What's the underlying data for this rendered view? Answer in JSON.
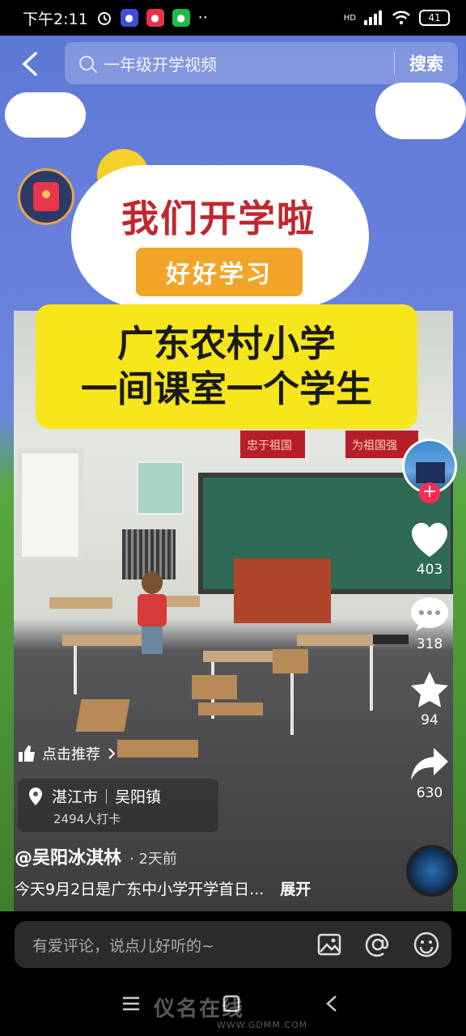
{
  "status_bar": {
    "time": "下午2:11",
    "network": "HD",
    "battery": "41"
  },
  "search": {
    "placeholder": "一年级开学视频",
    "button_label": "搜索"
  },
  "video": {
    "title_line": "我们开学啦",
    "ribbon": "好好学习",
    "headline_line1": "广东农村小学",
    "headline_line2": "一间课室一个学生",
    "banner_left": "忠于祖国",
    "banner_right": "为祖国强"
  },
  "actions": {
    "likes": "403",
    "comments": "318",
    "favorites": "94",
    "shares": "630"
  },
  "recommend": {
    "label": "点击推荐"
  },
  "location": {
    "city": "湛江市",
    "town": "吴阳镇",
    "checkins": "2494人打卡"
  },
  "post": {
    "author": "@吴阳冰淇林",
    "time": "· 2天前",
    "caption": "今天9月2日是广东中小学开学首日...",
    "expand_label": "展开"
  },
  "comment": {
    "placeholder": "有爱评论，说点儿好听的~"
  },
  "watermark": {
    "text": "仪名在线",
    "url": "WWW.GDMM.COM"
  },
  "colors": {
    "like_pink": "#fe2c55",
    "headline_bg": "#f6e61b",
    "title_red": "#c0272d"
  }
}
